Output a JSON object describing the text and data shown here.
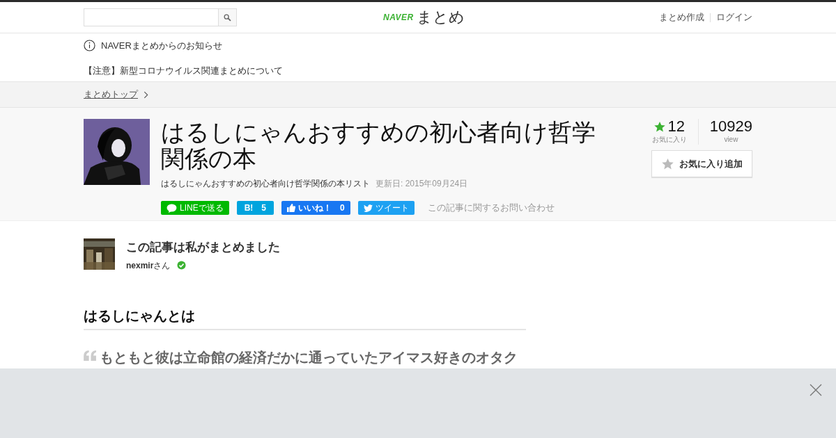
{
  "header": {
    "logo": {
      "brand": "NAVER",
      "name": "まとめ"
    },
    "links": [
      "まとめ作成",
      "ログイン"
    ]
  },
  "notice": {
    "title": "NAVERまとめからのお知らせ",
    "item": "【注意】新型コロナウイルス関連まとめについて"
  },
  "breadcrumb": "まとめトップ",
  "article": {
    "title": "はるしにゃんおすすめの初心者向け哲学関係の本",
    "description": "はるしにゃんおすすめの初心者向け哲学関係の本リスト",
    "updated": "更新日: 2015年09月24日",
    "share": [
      {
        "kind": "line",
        "label": "LINEで送る"
      },
      {
        "kind": "hatena",
        "label": "B!",
        "count": "5"
      },
      {
        "kind": "facebook",
        "label": "いいね！",
        "count": "0"
      },
      {
        "kind": "twitter",
        "label": "ツイート"
      }
    ],
    "contact": "この記事に関するお問い合わせ",
    "stats": {
      "favorites": "12",
      "favorites_label": "お気に入り",
      "views": "10929",
      "views_label": "view"
    },
    "favorite_button": "お気に入り追加"
  },
  "curator": {
    "heading": "この記事は私がまとめました",
    "name": "nexmir",
    "suffix": "さん",
    "verified": true
  },
  "section": {
    "heading": "はるしにゃんとは",
    "quote": "もともと彼は立命館の経済だかに通っていたアイマス好きのオタク"
  },
  "overlay": {
    "closable": true
  }
}
